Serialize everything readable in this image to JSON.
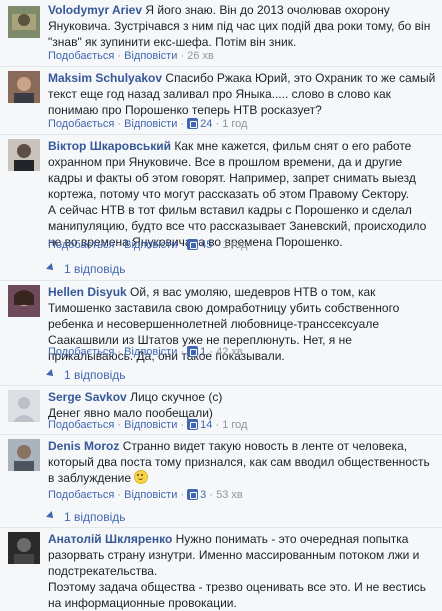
{
  "comments": [
    {
      "name": "",
      "text": "Я його знаю. Він до 2013 очолював охорону Януковича. Зустрічався з ним під час цих подій два роки тому, бо він \"знав\" як зупинити екс-шефа. Потім він зник.",
      "like": "Подобається",
      "reply": "Відповісти",
      "time": "26 хв",
      "likes": ""
    },
    {
      "name": "Maksim Schulyakov",
      "text": "Спасибо Ржака Юрий, это Охраник то же самый текст еще год назад заливал про Яныка..... слово в слово как понимаю про Порошенко теперь НТВ росказует?",
      "like": "Подобається",
      "reply": "Відповісти",
      "time": "1 год",
      "likes": "24"
    },
    {
      "name": "Віктор Шкаровський",
      "text": "Как мне кажется, фильм снят о его работе охранном при Януковиче. Все в прошлом времени, да и другие кадры и факты об этом говорят. Например, запрет снимать выезд кортежа, потому что могут рассказать об этом Правому Сектору.",
      "text2": "А сейчас НТВ в тот фильм вставил кадры с Порошенко и сделал манипуляцию, будто все что рассказывает Заневский, происходило не во времена Януковича, а во времена Порошенко.",
      "like": "Подобається",
      "reply": "Відповісти",
      "time": "1 год",
      "likes": "45",
      "replies": "1 відповідь"
    },
    {
      "name": "Hellen Disyuk",
      "text": "Ой, я вас умоляю, шедевров НТВ о том, как Тимошенко заставила свою домработницу убить собственного ребенка и несовершеннолетней любовнице-транссексуале Саакашвили из Штатов уже не переплюнуть. Нет, я не прикалываюсь. Да, они такое показывали.",
      "like": "Подобається",
      "reply": "Відповісти",
      "time": "42 хв",
      "likes": "1",
      "replies": "1 відповідь"
    },
    {
      "name": "Serge Savkov",
      "text": "Лицо скучное (с)",
      "text2": "Денег явно мало пообещали)",
      "like": "Подобається",
      "reply": "Відповісти",
      "time": "1 год",
      "likes": "14"
    },
    {
      "name": "Denis Moroz",
      "text": "Странно видет такую новость в ленте от человека, который два поста тому признался, как сам вводил общественность в заблуждение",
      "like": "Подобається",
      "reply": "Відповісти",
      "time": "53 хв",
      "likes": "3",
      "replies": "1 відповідь"
    },
    {
      "name": "Анатолій Шкляренко",
      "text": "Нужно понимать - это очередная попытка разорвать страну изнутри. Именно массированным потоком лжи и подстрекательства.",
      "text2": "Поэтому задача общества - трезво оценивать все это. И не вестись на информационные провокации."
    }
  ],
  "first_name": "Volodymyr Ariev",
  "separator": "·",
  "colors": {
    "link": "#365899",
    "meta": "#90949c",
    "accent": "#4267b2"
  }
}
